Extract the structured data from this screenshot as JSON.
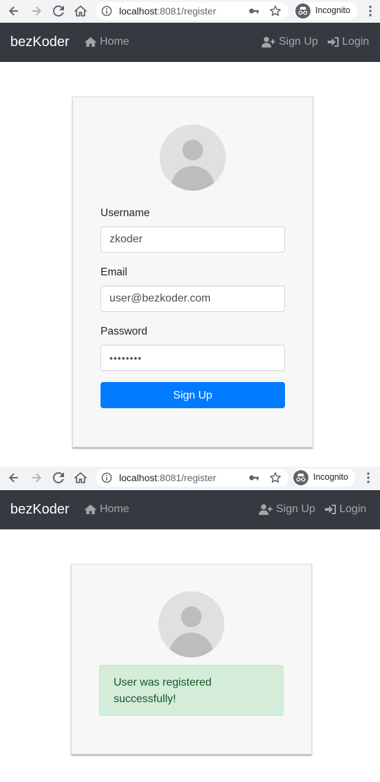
{
  "browser": {
    "url_host": "localhost",
    "url_rest": ":8081/register",
    "incognito_label": "Incognito"
  },
  "navbar": {
    "brand": "bezKoder",
    "home": "Home",
    "signup": "Sign Up",
    "login": "Login"
  },
  "form": {
    "username_label": "Username",
    "username_value": "zkoder",
    "email_label": "Email",
    "email_value": "user@bezkoder.com",
    "password_label": "Password",
    "password_value": "••••••••",
    "submit_label": "Sign Up"
  },
  "result": {
    "message": "User was registered successfully!"
  },
  "colors": {
    "navbar_bg": "#343a40",
    "primary": "#007bff",
    "success_bg": "#d4edda",
    "success_text": "#155724"
  }
}
